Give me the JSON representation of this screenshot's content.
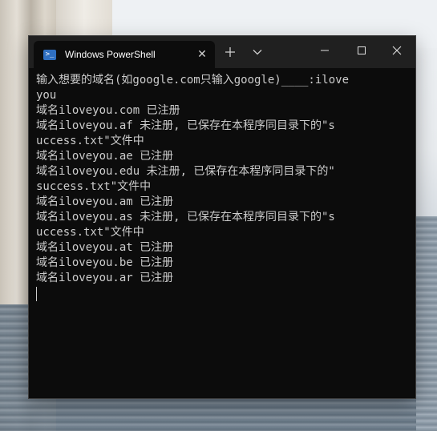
{
  "window": {
    "tab_title": "Windows PowerShell",
    "tab_icon_glyph": ">_"
  },
  "console": {
    "lines": [
      "输入想要的域名(如google.com只输入google)____:ilove",
      "you",
      "域名iloveyou.com 已注册",
      "域名iloveyou.af 未注册, 已保存在本程序同目录下的\"s",
      "uccess.txt\"文件中",
      "域名iloveyou.ae 已注册",
      "域名iloveyou.edu 未注册, 已保存在本程序同目录下的\"",
      "success.txt\"文件中",
      "域名iloveyou.am 已注册",
      "域名iloveyou.as 未注册, 已保存在本程序同目录下的\"s",
      "uccess.txt\"文件中",
      "域名iloveyou.at 已注册",
      "域名iloveyou.be 已注册",
      "域名iloveyou.ar 已注册"
    ]
  },
  "colors": {
    "console_bg": "#0c0c0c",
    "console_fg": "#cccccc",
    "titlebar_bg": "#202020",
    "accent": "#2f6fc1"
  }
}
